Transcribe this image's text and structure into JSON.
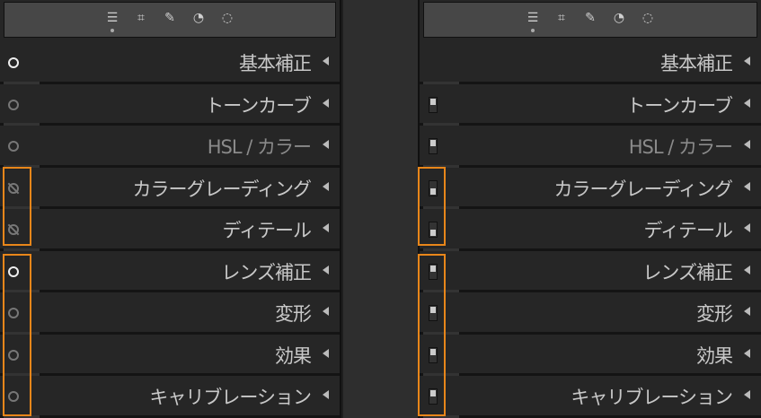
{
  "toolbar": {
    "icons": [
      "sliders-icon",
      "crop-icon",
      "healing-icon",
      "redeye-icon",
      "mask-icon"
    ],
    "glyphs": [
      "☰",
      "⌗",
      "✎",
      "◔",
      "◌"
    ]
  },
  "panels": [
    "基本補正",
    "トーンカーブ",
    "HSL / カラー",
    "カラーグレーディング",
    "ディテール",
    "レンズ補正",
    "変形",
    "効果",
    "キャリブレーション"
  ],
  "left_eye_states": [
    "on",
    "dim",
    "dim",
    "off",
    "off",
    "on",
    "dim",
    "dim",
    "dim"
  ],
  "right_switch_states": [
    "none",
    "on",
    "on",
    "off",
    "off",
    "on",
    "on",
    "on",
    "on"
  ],
  "accent": "#e8861a"
}
